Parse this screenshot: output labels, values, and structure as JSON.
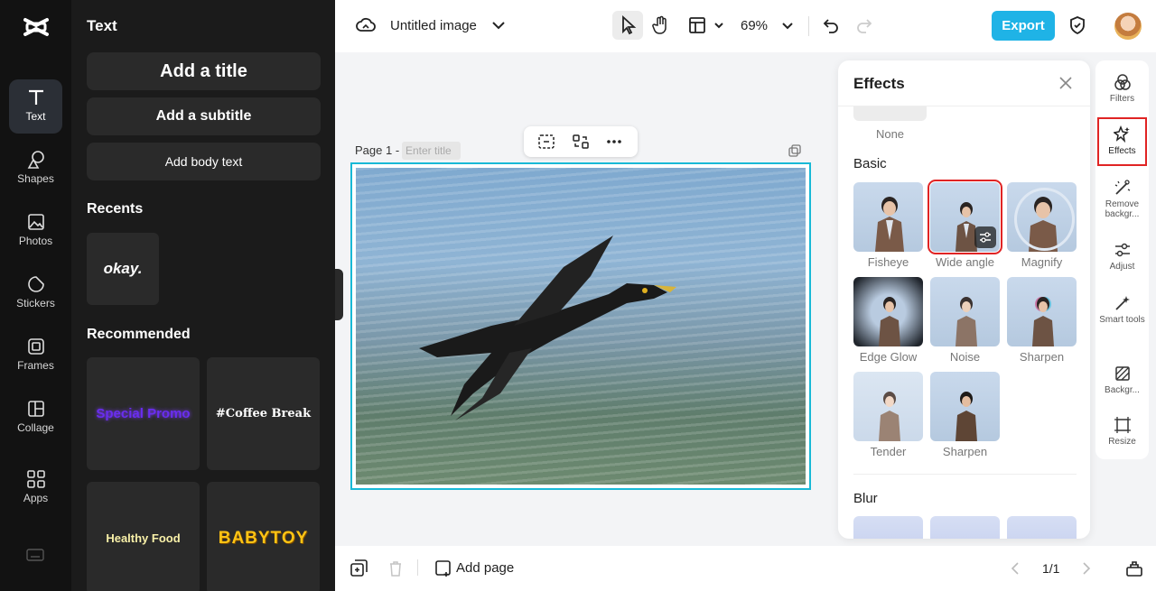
{
  "app": {
    "logo_icon": "capcut-logo-icon",
    "doc_title": "Untitled image",
    "zoom": "69%",
    "export_label": "Export",
    "accent_color": "#1fb3e6"
  },
  "rail": {
    "items": [
      {
        "label": "Text",
        "icon": "text-icon"
      },
      {
        "label": "Shapes",
        "icon": "shapes-icon"
      },
      {
        "label": "Photos",
        "icon": "photos-icon"
      },
      {
        "label": "Stickers",
        "icon": "stickers-icon"
      },
      {
        "label": "Frames",
        "icon": "frames-icon"
      },
      {
        "label": "Collage",
        "icon": "collage-icon"
      },
      {
        "label": "Apps",
        "icon": "apps-icon"
      }
    ]
  },
  "text_panel": {
    "title": "Text",
    "add_title": "Add a title",
    "add_subtitle": "Add a subtitle",
    "add_body": "Add body text",
    "recents_label": "Recents",
    "recent_item": "okay.",
    "recommended_label": "Recommended",
    "recommended": [
      "Special Promo",
      "#Coffee Break",
      "Healthy Food",
      "BABYTOY"
    ]
  },
  "canvas": {
    "page_label": "Page 1 -",
    "title_placeholder": "Enter title"
  },
  "effects": {
    "title": "Effects",
    "none_label": "None",
    "basic_label": "Basic",
    "basic_items": [
      "Fisheye",
      "Wide angle",
      "Magnify",
      "Edge Glow",
      "Noise",
      "Sharpen",
      "Tender",
      "Sharpen"
    ],
    "selected": "Wide angle",
    "blur_label": "Blur"
  },
  "right_rail": {
    "items": [
      {
        "label": "Filters",
        "icon": "filters-icon"
      },
      {
        "label": "Effects",
        "icon": "effects-icon"
      },
      {
        "label": "Remove backgr...",
        "icon": "remove-background-icon"
      },
      {
        "label": "Adjust",
        "icon": "adjust-icon"
      },
      {
        "label": "Smart tools",
        "icon": "smart-tools-icon"
      },
      {
        "label": "Backgr...",
        "icon": "background-icon"
      },
      {
        "label": "Resize",
        "icon": "resize-icon"
      }
    ],
    "active": "Effects"
  },
  "bottom": {
    "add_page": "Add page",
    "page_count": "1/1"
  }
}
